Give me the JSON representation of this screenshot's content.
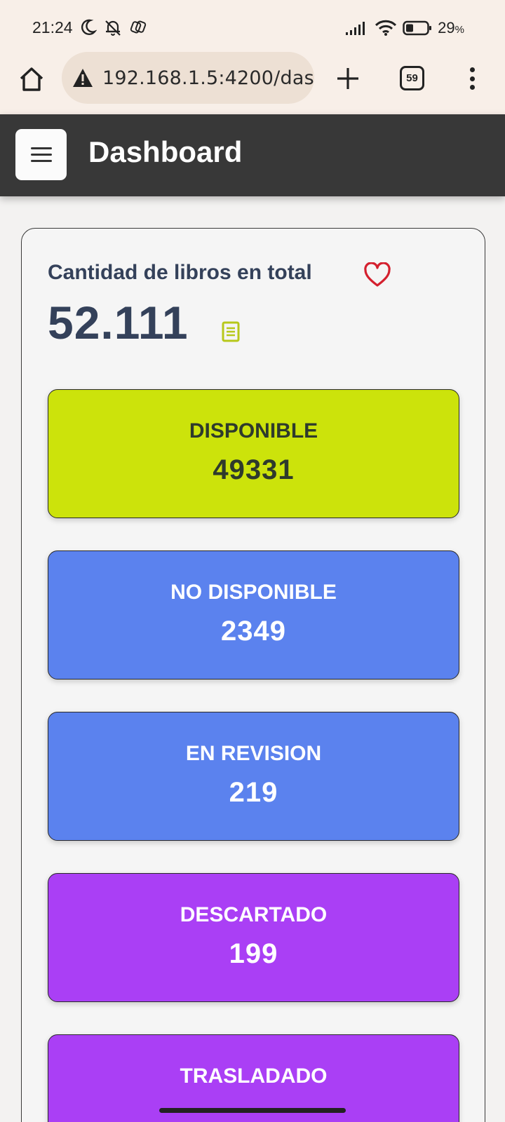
{
  "status_bar": {
    "time": "21:24",
    "battery_percent": "29",
    "battery_unit": "%"
  },
  "browser": {
    "url": "192.168.1.5:4200/das",
    "tab_count": "59"
  },
  "header": {
    "title": "Dashboard"
  },
  "summary": {
    "heading": "Cantidad de libros en total",
    "total": "52.111"
  },
  "status_tiles": [
    {
      "label": "DISPONIBLE",
      "count": "49331",
      "color": "#cce30b",
      "text_color": "#2e3a2c"
    },
    {
      "label": "NO DISPONIBLE",
      "count": "2349",
      "color": "#5b82ee",
      "text_color": "#ffffff"
    },
    {
      "label": "EN REVISION",
      "count": "219",
      "color": "#5b82ee",
      "text_color": "#ffffff"
    },
    {
      "label": "DESCARTADO",
      "count": "199",
      "color": "#aa3ff5",
      "text_color": "#ffffff"
    },
    {
      "label": "TRASLADADO",
      "count": "",
      "color": "#aa3ff5",
      "text_color": "#ffffff"
    }
  ],
  "colors": {
    "header_bg": "#383838",
    "accent_heart": "#d4202e",
    "book_icon": "#b7c81a",
    "heading_text": "#34415a"
  }
}
